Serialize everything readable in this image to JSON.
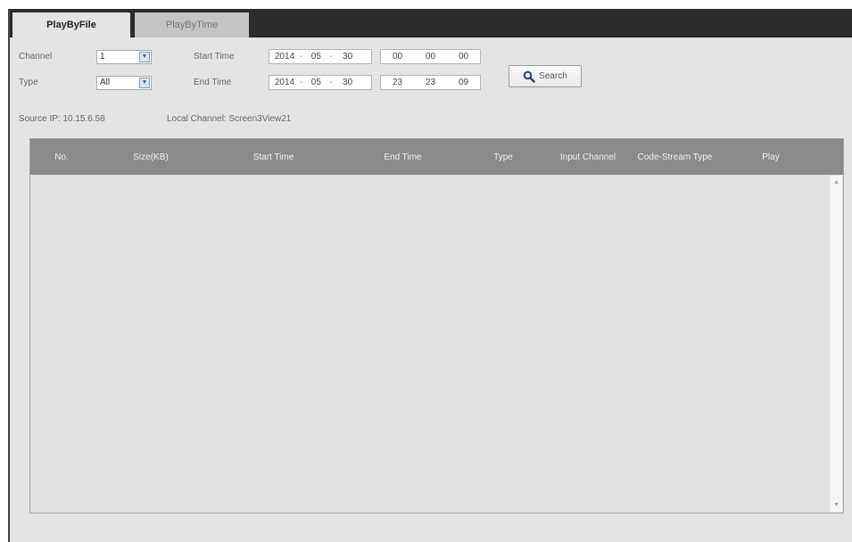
{
  "tabs": {
    "active_label": "PlayByFile",
    "inactive_label": "PlayByTime"
  },
  "filters": {
    "channel_label": "Channel",
    "channel_value": "1",
    "type_label": "Type",
    "type_value": "All",
    "start_time_label": "Start Time",
    "end_time_label": "End Time",
    "start": {
      "year": "2014",
      "month": "05",
      "day": "30",
      "hour": "00",
      "minute": "00",
      "second": "00"
    },
    "end": {
      "year": "2014",
      "month": "05",
      "day": "30",
      "hour": "23",
      "minute": "23",
      "second": "09"
    },
    "date_sep": "-"
  },
  "search_button": {
    "label": "Search"
  },
  "info": {
    "source_ip": "Source IP: 10.15.6.58",
    "local_channel": "Local Channel: Screen3View21"
  },
  "table": {
    "columns": [
      "No.",
      "Size(KB)",
      "Start Time",
      "End Time",
      "Type",
      "Input Channel",
      "Code-Stream Type",
      "Play"
    ],
    "rows": []
  },
  "icons": {
    "search": "magnifier-icon",
    "dropdown": "chevron-down-icon"
  }
}
